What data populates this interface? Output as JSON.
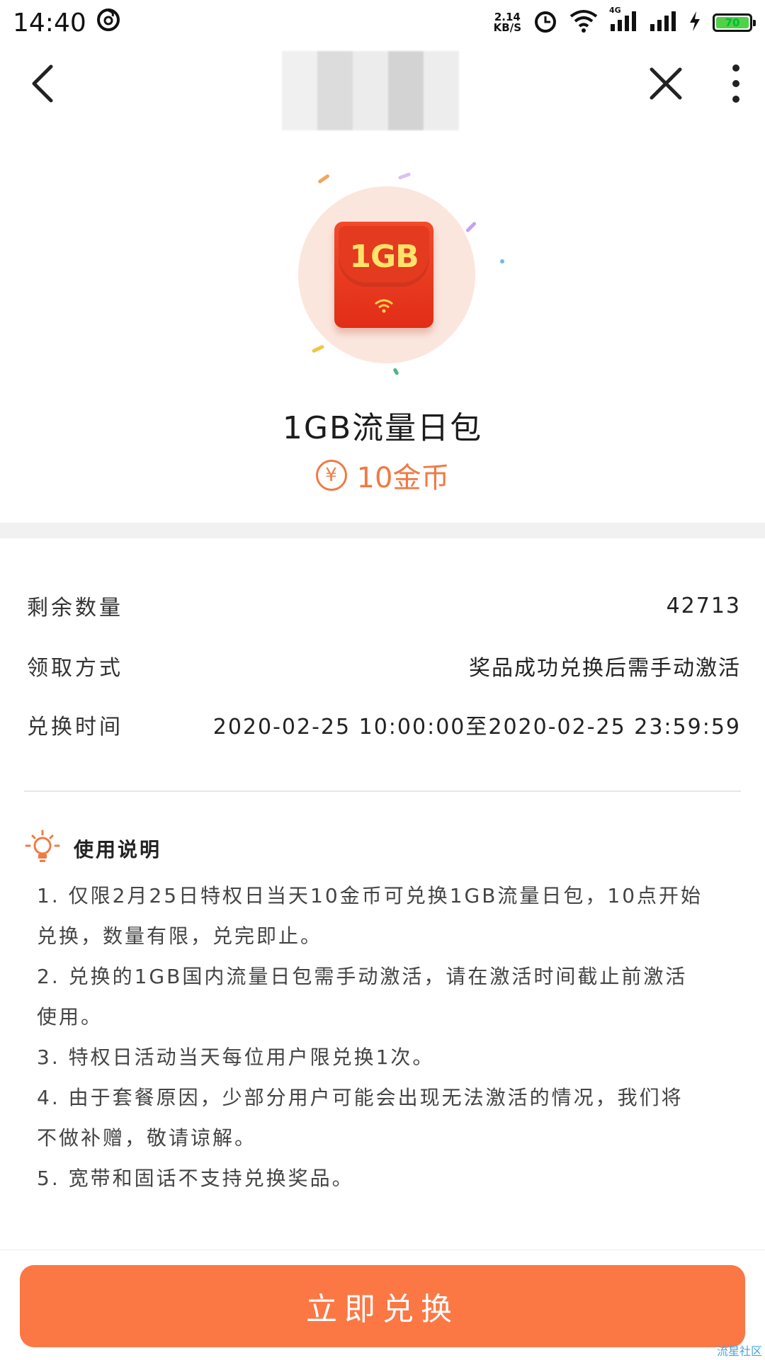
{
  "status_bar": {
    "time": "14:40",
    "net_speed_value": "2.14",
    "net_speed_unit": "KB/S",
    "network_type": "4G",
    "battery_level": "70"
  },
  "product": {
    "badge_text": "1GB",
    "title": "1GB流量日包",
    "price": "10金币",
    "coin_symbol": "¥"
  },
  "details": [
    {
      "label": "剩余数量",
      "value": "42713"
    },
    {
      "label": "领取方式",
      "value": "奖品成功兑换后需手动激活"
    },
    {
      "label": "兑换时间",
      "value": "2020-02-25 10:00:00至2020-02-25 23:59:59"
    }
  ],
  "usage": {
    "title": "使用说明",
    "items": [
      "1. 仅限2月25日特权日当天10金币可兑换1GB流量日包，10点开始",
      "兑换，数量有限，兑完即止。",
      "2. 兑换的1GB国内流量日包需手动激活，请在激活时间截止前激活",
      "使用。",
      "3. 特权日活动当天每位用户限兑换1次。",
      "4. 由于套餐原因，少部分用户可能会出现无法激活的情况，我们将",
      "不做补赠，敬请谅解。",
      "5. 宽带和固话不支持兑换奖品。"
    ]
  },
  "cta_label": "立即兑换",
  "watermark": "流星社区",
  "colors": {
    "accent": "#fb7845",
    "price": "#f07a44",
    "envelope": "#e3341c"
  }
}
